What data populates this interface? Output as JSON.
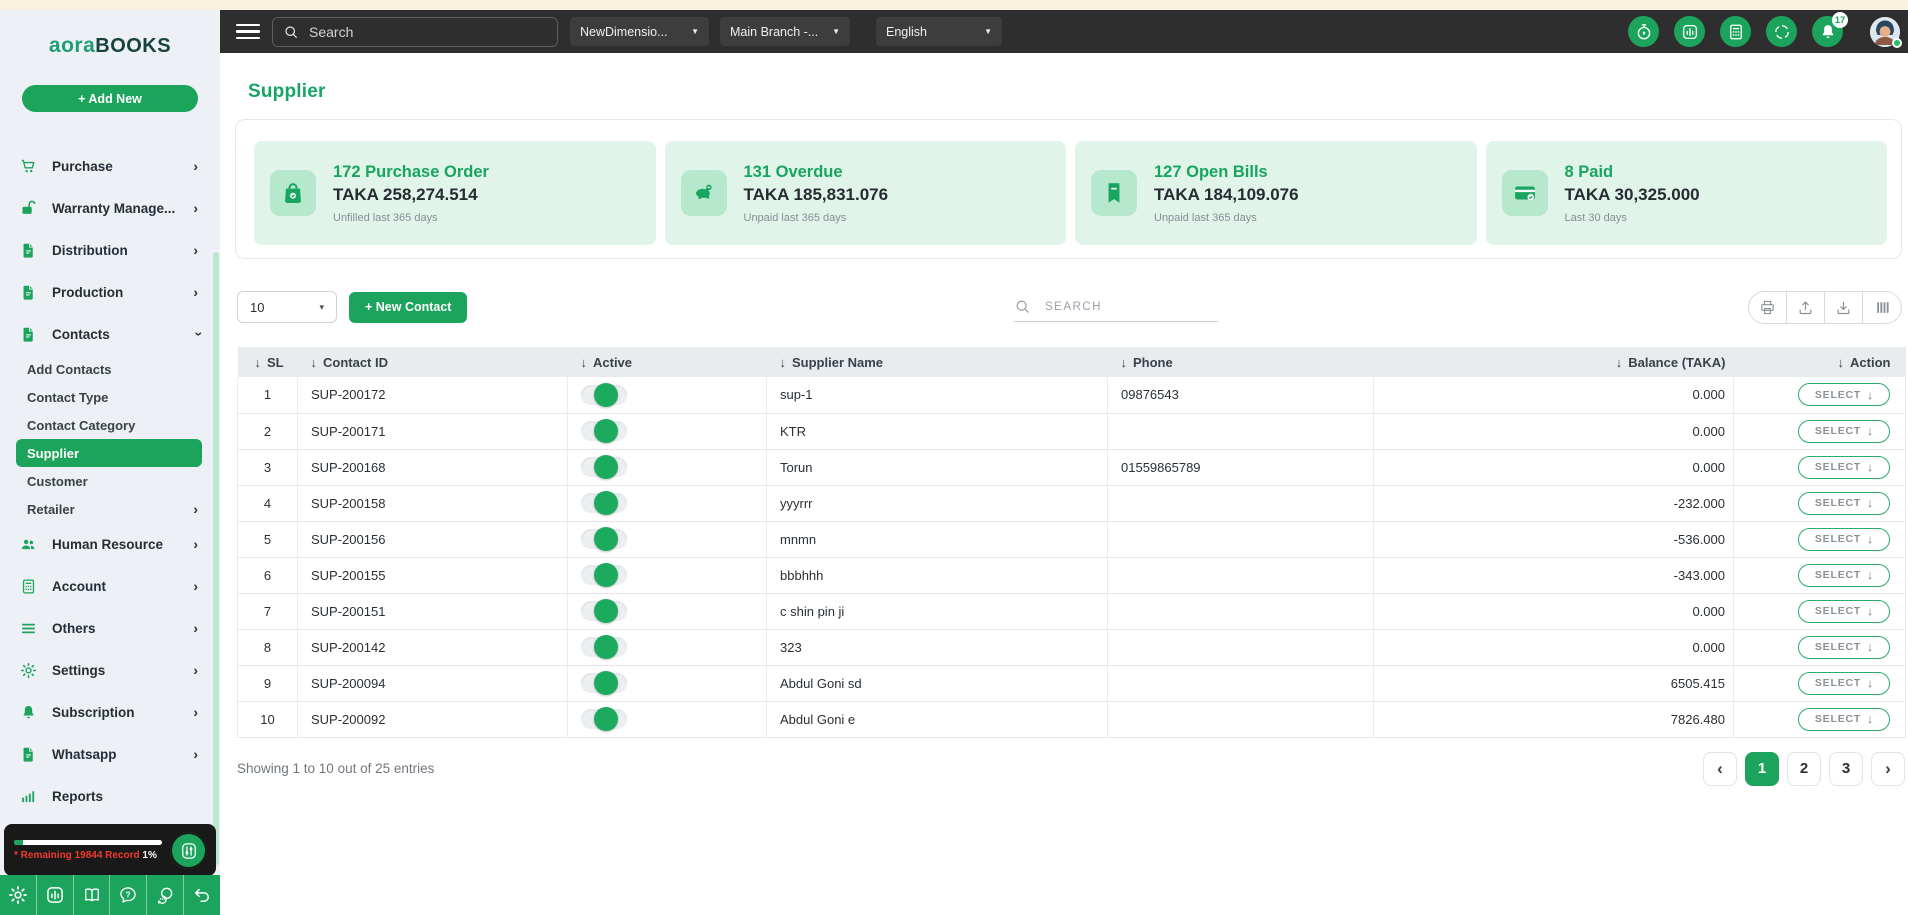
{
  "topbar": {
    "search_placeholder": "Search",
    "dropdowns": [
      {
        "name": "company-dropdown",
        "label": "NewDimensio...",
        "caret": "▼"
      },
      {
        "name": "branch-dropdown",
        "label": "Main Branch -...",
        "caret": "▼"
      },
      {
        "name": "language-dropdown",
        "label": "English",
        "caret": "▼"
      }
    ],
    "icons": [
      {
        "name": "timer-icon",
        "icon": "#i-timer",
        "classes": ""
      },
      {
        "name": "chart-icon",
        "icon": "#i-chart-box",
        "classes": ""
      },
      {
        "name": "calculator-icon",
        "icon": "#i-calc",
        "classes": ""
      },
      {
        "name": "scan-icon",
        "icon": "#i-scan",
        "classes": ""
      },
      {
        "name": "bell-icon",
        "icon": "#i-bell",
        "classes": "has-badge",
        "badge": "17"
      }
    ]
  },
  "sidebar": {
    "logo_primary": "aora",
    "logo_secondary": "BOOKS",
    "add_new": "+ Add New",
    "items": [
      {
        "label": "Purchase",
        "icon": "#i-cart",
        "chevron": "›",
        "classes": "main"
      },
      {
        "label": "Warranty Manage...",
        "icon": "#i-lock-open",
        "chevron": "›",
        "classes": "main"
      },
      {
        "label": "Distribution",
        "icon": "#i-doc",
        "chevron": "›",
        "classes": "main"
      },
      {
        "label": "Production",
        "icon": "#i-doc",
        "chevron": "›",
        "classes": "main"
      },
      {
        "label": "Contacts",
        "icon": "#i-doc",
        "chevron": "›",
        "classes": "main open"
      },
      {
        "label": "Add Contacts",
        "icon": "",
        "chevron": "",
        "classes": "sub"
      },
      {
        "label": "Contact Type",
        "icon": "",
        "chevron": "",
        "classes": "sub"
      },
      {
        "label": "Contact Category",
        "icon": "",
        "chevron": "",
        "classes": "sub"
      },
      {
        "label": "Supplier",
        "icon": "",
        "chevron": "",
        "classes": "sub active"
      },
      {
        "label": "Customer",
        "icon": "",
        "chevron": "",
        "classes": "sub"
      },
      {
        "label": "Retailer",
        "icon": "",
        "chevron": "›",
        "classes": "sub"
      },
      {
        "label": "Human Resource",
        "icon": "#i-users",
        "chevron": "›",
        "classes": "main"
      },
      {
        "label": "Account",
        "icon": "#i-calc",
        "chevron": "›",
        "classes": "main"
      },
      {
        "label": "Others",
        "icon": "#i-lines",
        "chevron": "›",
        "classes": "main"
      },
      {
        "label": "Settings",
        "icon": "#i-gear",
        "chevron": "›",
        "classes": "main"
      },
      {
        "label": "Subscription",
        "icon": "#i-bell",
        "chevron": "›",
        "classes": "main"
      },
      {
        "label": "Whatsapp",
        "icon": "#i-doc",
        "chevron": "›",
        "classes": "main"
      },
      {
        "label": "Reports",
        "icon": "#i-bars",
        "chevron": "",
        "classes": "main"
      }
    ],
    "record_note": "* Remaining 19844 Record",
    "record_pct": "1%",
    "bottom_icons": [
      {
        "name": "settings-icon",
        "icon": "#i-gear"
      },
      {
        "name": "stats-icon",
        "icon": "#i-chart-box"
      },
      {
        "name": "docs-icon",
        "icon": "#i-book"
      },
      {
        "name": "help-icon",
        "icon": "#i-help"
      },
      {
        "name": "support-chat-icon",
        "icon": "#i-chat"
      },
      {
        "name": "undo-icon",
        "icon": "#i-undo"
      }
    ]
  },
  "page": {
    "title": "Supplier"
  },
  "cards": [
    {
      "title": "172 Purchase Order",
      "amount": "TAKA 258,274.514",
      "caption": "Unfilled last 365 days",
      "icon": "#i-bag"
    },
    {
      "title": "131 Overdue",
      "amount": "TAKA 185,831.076",
      "caption": "Unpaid last 365 days",
      "icon": "#i-piggy"
    },
    {
      "title": "127 Open Bills",
      "amount": "TAKA 184,109.076",
      "caption": "Unpaid last 365 days",
      "icon": "#i-bill"
    },
    {
      "title": "8 Paid",
      "amount": "TAKA 30,325.000",
      "caption": "Last 30 days",
      "icon": "#i-card"
    }
  ],
  "controls": {
    "page_size": "10",
    "caret": "▾",
    "new_contact": "+ New Contact",
    "search_placeholder": "SEARCH",
    "tools": [
      {
        "name": "print-icon",
        "icon": "#i-print"
      },
      {
        "name": "export-icon",
        "icon": "#i-upload"
      },
      {
        "name": "download-icon",
        "icon": "#i-download"
      },
      {
        "name": "columns-icon",
        "icon": "#i-columns"
      }
    ]
  },
  "table": {
    "select_label": "SELECT",
    "select_arrow": "↓",
    "headers": [
      {
        "sort": "↓",
        "label": "SL",
        "cls": "h-sl"
      },
      {
        "sort": "↓",
        "label": "Contact ID",
        "cls": ""
      },
      {
        "sort": "↓",
        "label": "Active",
        "cls": ""
      },
      {
        "sort": "↓",
        "label": "Supplier Name",
        "cls": ""
      },
      {
        "sort": "↓",
        "label": "Phone",
        "cls": ""
      },
      {
        "sort": "↓",
        "label": "Balance (TAKA)",
        "cls": "h-right h-bal"
      },
      {
        "sort": "↓",
        "label": "Action",
        "cls": "h-right h-act"
      }
    ],
    "rows": [
      {
        "sl": "1",
        "contact_id": "SUP-200172",
        "name": "sup-1",
        "phone": "09876543",
        "balance": "0.000"
      },
      {
        "sl": "2",
        "contact_id": "SUP-200171",
        "name": "KTR",
        "phone": "",
        "balance": "0.000"
      },
      {
        "sl": "3",
        "contact_id": "SUP-200168",
        "name": "Torun",
        "phone": "01559865789",
        "balance": "0.000"
      },
      {
        "sl": "4",
        "contact_id": "SUP-200158",
        "name": "yyyrrr",
        "phone": "",
        "balance": "-232.000"
      },
      {
        "sl": "5",
        "contact_id": "SUP-200156",
        "name": "mnmn",
        "phone": "",
        "balance": "-536.000"
      },
      {
        "sl": "6",
        "contact_id": "SUP-200155",
        "name": "bbbhhh",
        "phone": "",
        "balance": "-343.000"
      },
      {
        "sl": "7",
        "contact_id": "SUP-200151",
        "name": "c shin pin ji",
        "phone": "",
        "balance": "0.000"
      },
      {
        "sl": "8",
        "contact_id": "SUP-200142",
        "name": "323",
        "phone": "",
        "balance": "0.000"
      },
      {
        "sl": "9",
        "contact_id": "SUP-200094",
        "name": "Abdul Goni sd",
        "phone": "",
        "balance": "6505.415"
      },
      {
        "sl": "10",
        "contact_id": "SUP-200092",
        "name": "Abdul Goni e",
        "phone": "",
        "balance": "7826.480"
      }
    ]
  },
  "footer": {
    "summary": "Showing 1 to 10 out of 25 entries",
    "pages": [
      {
        "label": "‹",
        "classes": "pg-nav"
      },
      {
        "label": "1",
        "classes": "pg-active"
      },
      {
        "label": "2",
        "classes": ""
      },
      {
        "label": "3",
        "classes": ""
      },
      {
        "label": "›",
        "classes": "pg-nav"
      }
    ]
  }
}
